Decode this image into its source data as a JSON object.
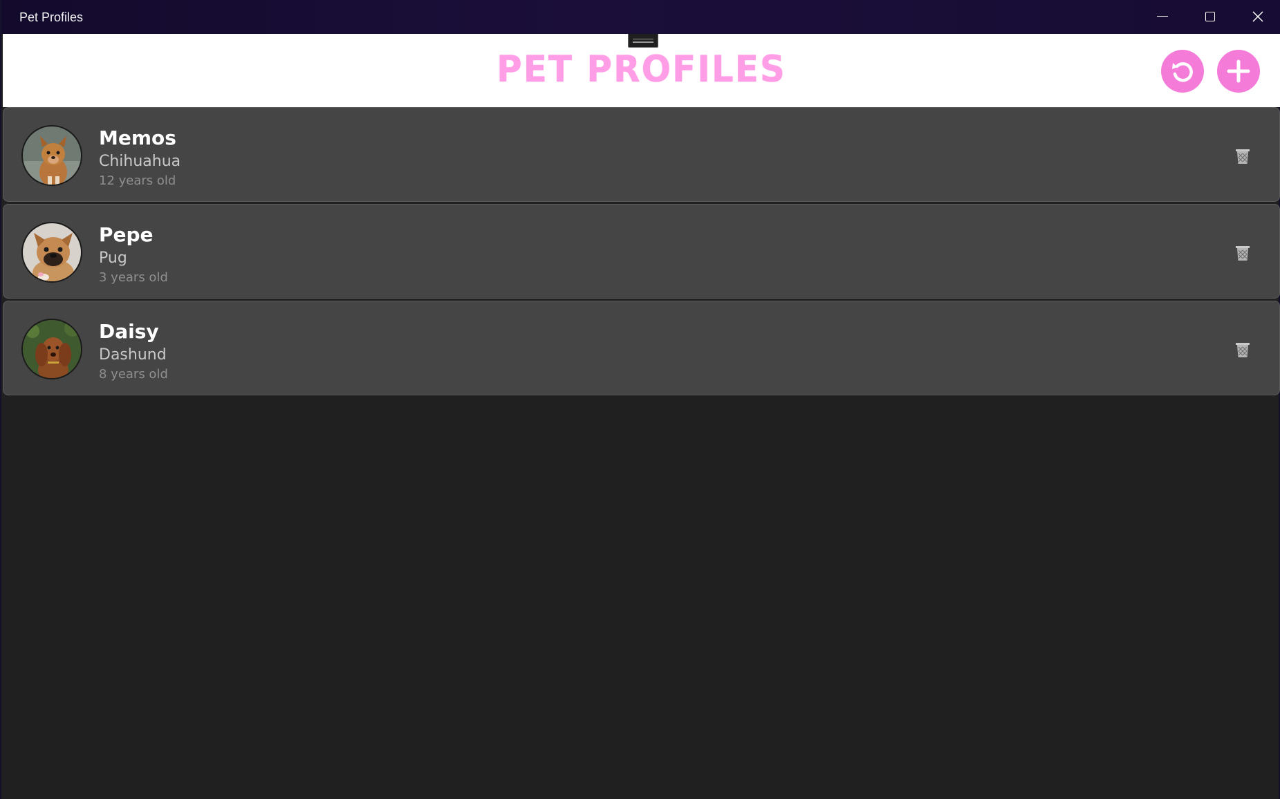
{
  "window": {
    "title": "Pet Profiles"
  },
  "header": {
    "title": "PET PROFILES",
    "refresh_icon": "refresh-icon",
    "add_icon": "plus-icon",
    "accent_color": "#f47bd8",
    "title_color": "#ff9ee6"
  },
  "pets": [
    {
      "name": "Memos",
      "breed": "Chihuahua",
      "age": "12 years old",
      "photo": "tan-dog"
    },
    {
      "name": "Pepe",
      "breed": "Pug",
      "age": "3 years old",
      "photo": "pug-puppy"
    },
    {
      "name": "Daisy",
      "breed": "Dashund",
      "age": "8 years old",
      "photo": "dachshund-puppy"
    }
  ],
  "colors": {
    "background": "#202020",
    "card": "#454545",
    "titlebar": "#1b0f3a"
  }
}
